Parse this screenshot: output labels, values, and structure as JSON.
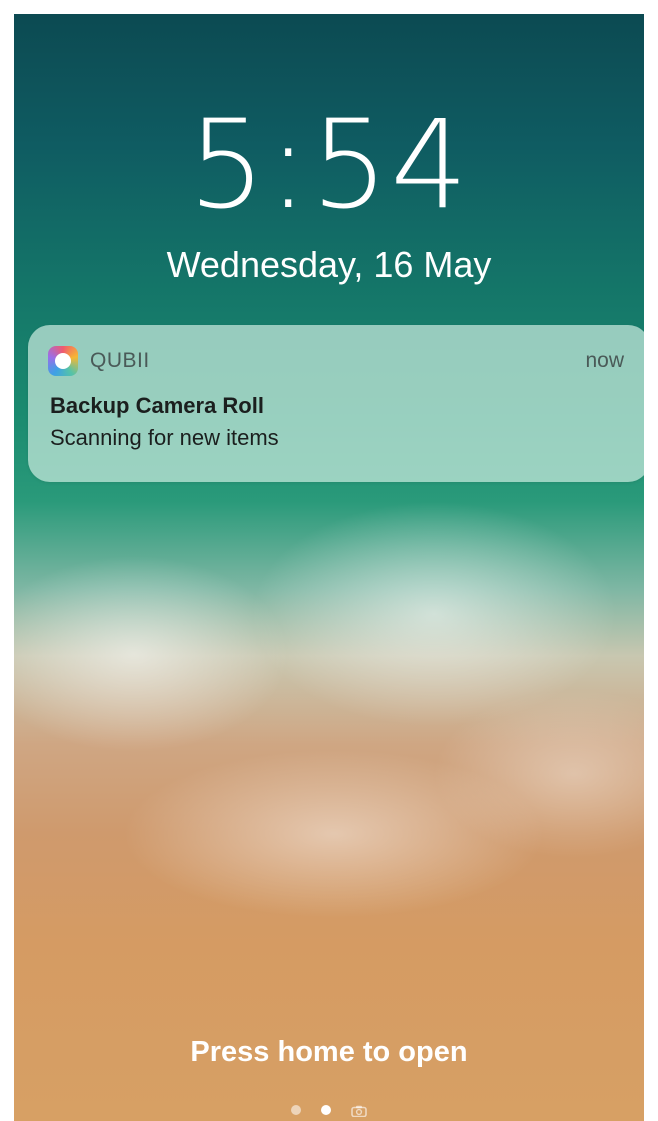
{
  "lock_screen": {
    "time": "5:54",
    "date": "Wednesday, 16 May",
    "hint": "Press home to open"
  },
  "notification": {
    "app_name": "QUBII",
    "time": "now",
    "title": "Backup Camera Roll",
    "body": "Scanning for new items",
    "app_icon": "qubii-app-icon"
  },
  "page_indicator": {
    "pages": [
      "page-dot",
      "page-dot-active",
      "camera-icon"
    ],
    "active_index": 1
  },
  "colors": {
    "text": "#ffffff",
    "notification_bg": "#c9eade",
    "ocean_top": "#0c4a52",
    "sand": "#d7a064"
  }
}
